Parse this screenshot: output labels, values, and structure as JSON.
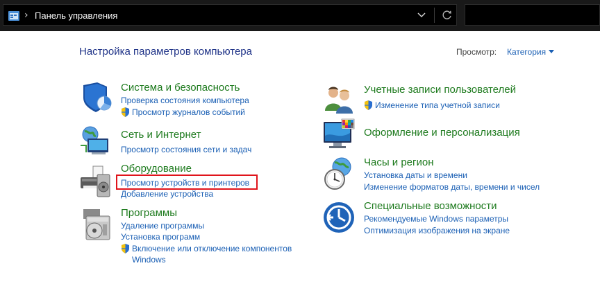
{
  "addressbar": {
    "separator": "›",
    "path": "Панель управления"
  },
  "header": {
    "title": "Настройка параметров компьютера",
    "view_label": "Просмотр:",
    "view_value": "Категория"
  },
  "categories": [
    {
      "title": "Система и безопасность",
      "icon": "security-shield-icon",
      "links": [
        "Проверка состояния компьютера",
        "Просмотр журналов событий"
      ]
    },
    {
      "title": "Сеть и Интернет",
      "icon": "network-globe-icon",
      "links": [
        "Просмотр состояния сети и задач"
      ]
    },
    {
      "title": "Оборудование",
      "icon": "printer-hardware-icon",
      "links": [
        "Просмотр устройств и принтеров",
        "Добавление устройства"
      ]
    },
    {
      "title": "Программы",
      "icon": "programs-disc-icon",
      "links": [
        "Удаление программы",
        "Установка программ",
        "Включение или отключение компонентов",
        "Windows"
      ]
    },
    {
      "title": "Учетные записи пользователей",
      "icon": "users-icon",
      "links": [
        "Изменение типа учетной записи"
      ]
    },
    {
      "title": "Оформление и персонализация",
      "icon": "monitor-palette-icon",
      "links": []
    },
    {
      "title": "Часы и регион",
      "icon": "clock-globe-icon",
      "links": [
        "Установка даты и времени",
        "Изменение форматов даты, времени и чисел"
      ]
    },
    {
      "title": "Специальные возможности",
      "icon": "accessibility-icon",
      "links": [
        "Рекомендуемые Windows параметры",
        "Оптимизация изображения на экране"
      ]
    }
  ],
  "colors": {
    "category_title": "#1d7a1d",
    "link": "#1a5fb4",
    "heading": "#1e3287",
    "highlight_box": "#e0141b"
  }
}
